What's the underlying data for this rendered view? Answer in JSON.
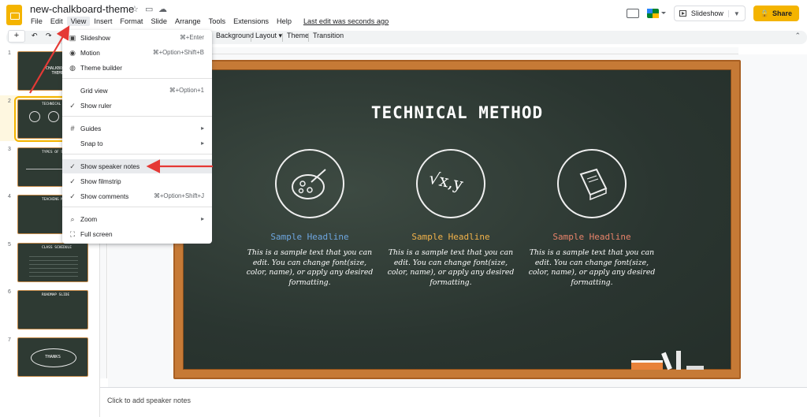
{
  "header": {
    "doc_title": "new-chalkboard-theme",
    "menu": [
      "File",
      "Edit",
      "View",
      "Insert",
      "Format",
      "Slide",
      "Arrange",
      "Tools",
      "Extensions",
      "Help"
    ],
    "last_edit": "Last edit was seconds ago",
    "slideshow_label": "Slideshow",
    "share_label": "Share"
  },
  "toolbar": {
    "background_label": "Background",
    "layout_label": "Layout",
    "theme_label": "Theme",
    "transition_label": "Transition"
  },
  "view_menu": {
    "items": [
      {
        "icon": "slideshow-icon",
        "label": "Slideshow",
        "shortcut": "⌘+Enter"
      },
      {
        "icon": "motion-icon",
        "label": "Motion",
        "shortcut": "⌘+Option+Shift+B"
      },
      {
        "icon": "palette-icon",
        "label": "Theme builder",
        "shortcut": ""
      },
      {
        "icon": "none",
        "label": "Grid view",
        "shortcut": "⌘+Option+1"
      },
      {
        "icon": "check-icon",
        "label": "Show ruler",
        "shortcut": ""
      },
      {
        "icon": "guides-icon",
        "label": "Guides",
        "shortcut": "▸"
      },
      {
        "icon": "none",
        "label": "Snap to",
        "shortcut": "▸"
      },
      {
        "icon": "check-icon",
        "label": "Show speaker notes",
        "shortcut": ""
      },
      {
        "icon": "check-icon",
        "label": "Show filmstrip",
        "shortcut": ""
      },
      {
        "icon": "check-icon",
        "label": "Show comments",
        "shortcut": "⌘+Option+Shift+J"
      },
      {
        "icon": "zoom-icon",
        "label": "Zoom",
        "shortcut": "▸"
      },
      {
        "icon": "fullscreen-icon",
        "label": "Full screen",
        "shortcut": ""
      }
    ]
  },
  "filmstrip": {
    "numbers": [
      "1",
      "2",
      "3",
      "4",
      "5",
      "6",
      "7"
    ],
    "thumb_texts": [
      "CHALKBOARD THEME",
      "TECHNICAL METHOD",
      "TYPES OF SCIENCE",
      "TEACHING METHODS",
      "CLASS SCHEDULE",
      "ROADMAP SLIDE",
      "THANKS"
    ]
  },
  "slide": {
    "title": "TECHNICAL METHOD",
    "columns": [
      {
        "headline": "Sample Headline",
        "color": "#6ea6e0",
        "body": "This is a sample text that you can edit. You can change font(size, color, name), or apply any desired formatting."
      },
      {
        "headline": "Sample Headline",
        "color": "#f2b24a",
        "body": "This is a sample text that you can edit. You can change font(size, color, name), or apply any desired formatting."
      },
      {
        "headline": "Sample Headline",
        "color": "#e8836a",
        "body": "This is a sample text that you can edit. You can change font(size, color, name), or apply any desired formatting."
      }
    ],
    "icon_vxy": "√x,y"
  },
  "notes": {
    "placeholder": "Click to add speaker notes"
  }
}
